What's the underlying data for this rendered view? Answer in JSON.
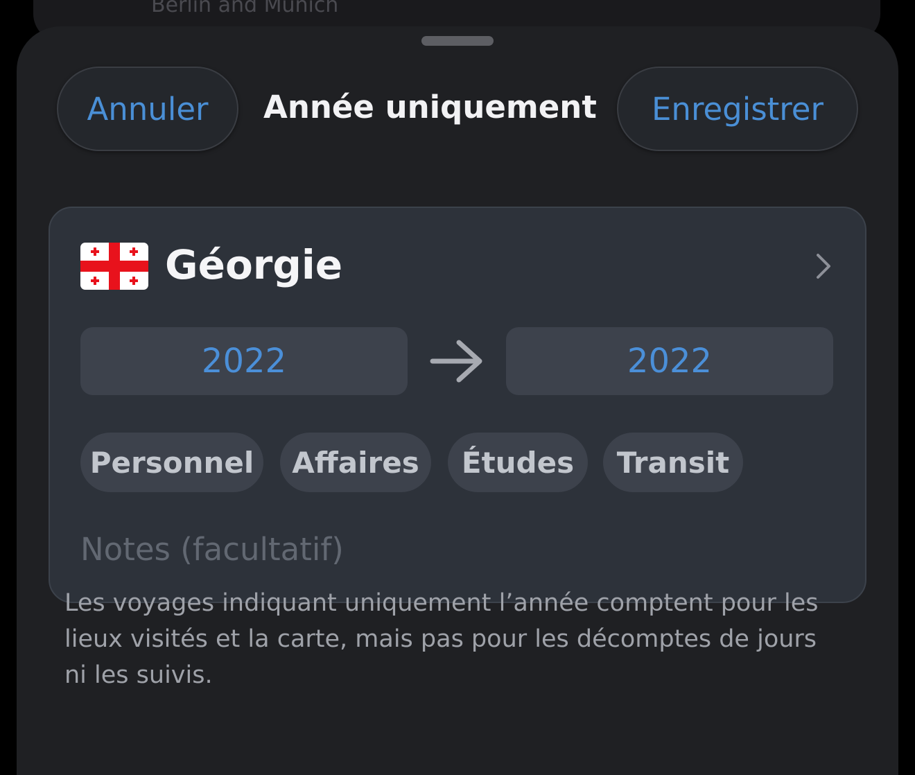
{
  "background_card": {
    "text": "Berlin and Munich"
  },
  "sheet": {
    "cancel_label": "Annuler",
    "title": "Année uniquement",
    "save_label": "Enregistrer"
  },
  "trip": {
    "flag_icon": "georgia-flag-icon",
    "country": "Géorgie",
    "year_start": "2022",
    "year_end": "2022",
    "tags": [
      "Personnel",
      "Affaires",
      "Études",
      "Transit"
    ],
    "notes_placeholder": "Notes (facultatif)"
  },
  "footnote": "Les voyages indiquant uniquement l’année comptent pour les lieux visités et la carte, mais pas pour les décomptes de jours ni les suivis.",
  "colors": {
    "accent": "#4a8fd6",
    "sheet_background": "#1f2023",
    "card_background": "#2d323a",
    "flag_red": "#e8121c"
  }
}
